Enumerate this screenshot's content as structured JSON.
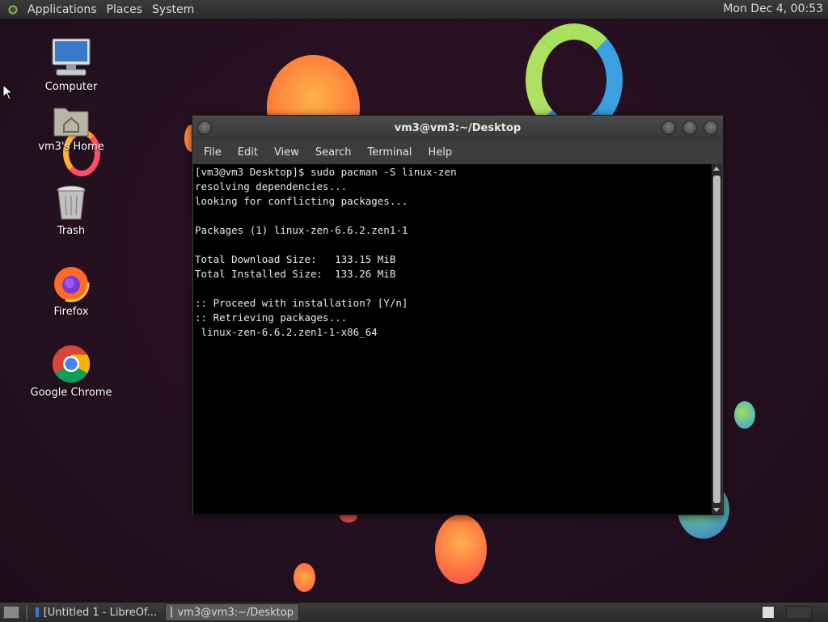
{
  "top_panel": {
    "menus": [
      "Applications",
      "Places",
      "System"
    ],
    "clock": "Mon Dec  4, 00:53"
  },
  "desktop_icons": [
    {
      "label": "Computer",
      "icon": "computer-icon"
    },
    {
      "label": "vm3's Home",
      "icon": "home-folder-icon"
    },
    {
      "label": "Trash",
      "icon": "trash-icon"
    },
    {
      "label": "Firefox",
      "icon": "firefox-icon"
    },
    {
      "label": "Google Chrome",
      "icon": "chrome-icon"
    }
  ],
  "terminal": {
    "title": "vm3@vm3:~/Desktop",
    "menu": [
      "File",
      "Edit",
      "View",
      "Search",
      "Terminal",
      "Help"
    ],
    "lines": [
      "[vm3@vm3 Desktop]$ sudo pacman -S linux-zen",
      "resolving dependencies...",
      "looking for conflicting packages...",
      "",
      "Packages (1) linux-zen-6.6.2.zen1-1",
      "",
      "Total Download Size:   133.15 MiB",
      "Total Installed Size:  133.26 MiB",
      "",
      ":: Proceed with installation? [Y/n]",
      ":: Retrieving packages...",
      " linux-zen-6.6.2.zen1-1-x86_64"
    ]
  },
  "taskbar": {
    "tasks": [
      {
        "label": "[Untitled 1 - LibreOf...",
        "icon": "libreoffice-writer-icon",
        "active": false
      },
      {
        "label": "vm3@vm3:~/Desktop",
        "icon": "terminal-icon",
        "active": true
      }
    ]
  },
  "colors": {
    "wallpaper": "#24101f",
    "panel": "#333333",
    "terminal_bg": "#000000",
    "terminal_fg": "#e8e8e8"
  }
}
